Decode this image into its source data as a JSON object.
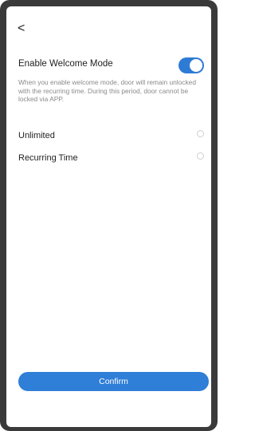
{
  "nav": {
    "back_glyph": "<"
  },
  "welcome": {
    "title": "Enable Welcome Mode",
    "enabled": true,
    "description": "When you enable welcome mode, door will remain unlocked with the recurring time. During this period, door cannot be locked via APP."
  },
  "options": [
    {
      "label": "Unlimited",
      "selected": false
    },
    {
      "label": "Recurring Time",
      "selected": false
    }
  ],
  "confirm_label": "Confirm",
  "colors": {
    "accent": "#2e7bd6",
    "frame": "#3a3a3a"
  }
}
